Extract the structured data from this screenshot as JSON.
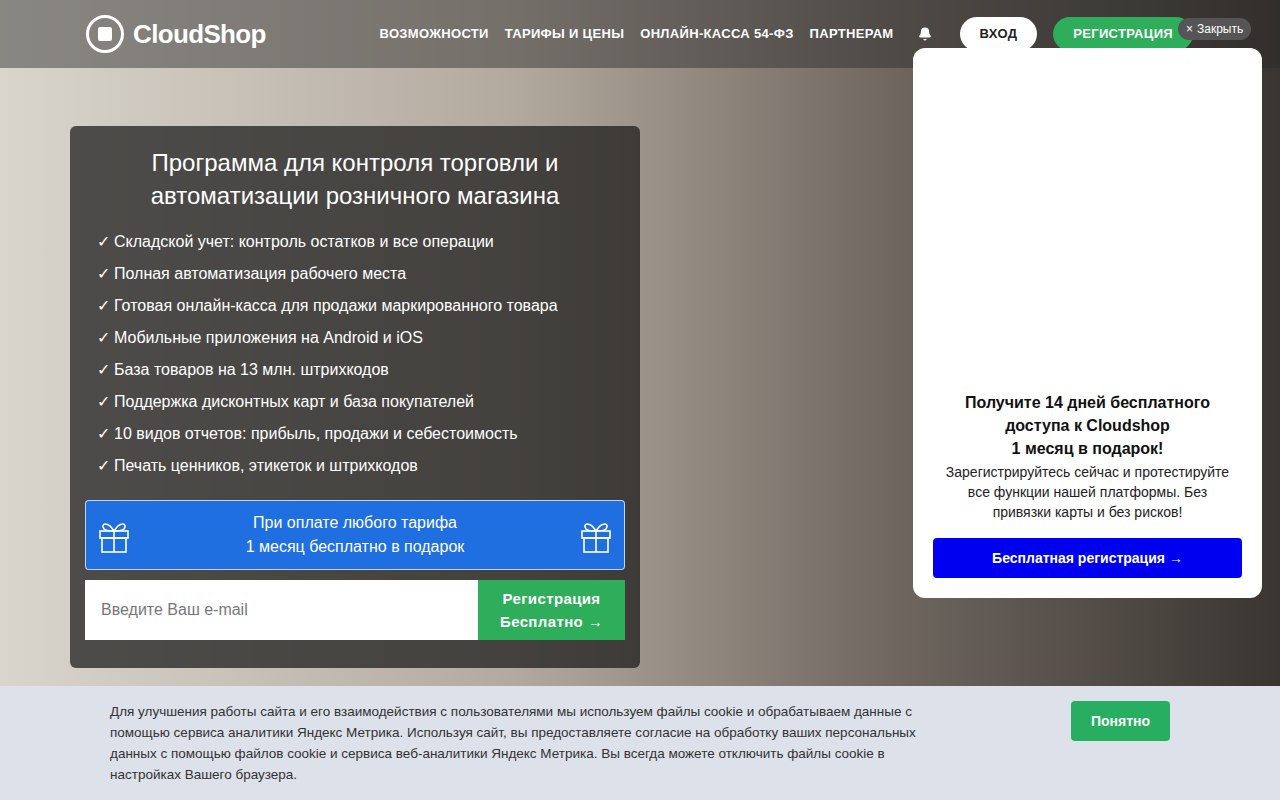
{
  "header": {
    "logo": "CloudShop",
    "nav": [
      "ВОЗМОЖНОСТИ",
      "ТАРИФЫ И ЦЕНЫ",
      "ОНЛАЙН-КАССА 54-ФЗ",
      "ПАРТНЕРАМ"
    ],
    "login": "ВХОД",
    "register": "РЕГИСТРАЦИЯ",
    "close": {
      "icon": "×",
      "label": "Закрыть"
    }
  },
  "hero": {
    "title_lines": [
      "Программа для контроля торговли и",
      "автоматизации розничного магазина"
    ],
    "check": "✓",
    "features": [
      "Складской учет: контроль остатков и все операции",
      "Полная автоматизация рабочего места",
      "Готовая онлайн-касса для продажи маркированного товара",
      "Мобильные приложения на Android и iOS",
      "База товаров на 13 млн. штрихкодов",
      "Поддержка дисконтных карт и база покупателей",
      "10 видов отчетов: прибыль, продажи и себестоимость",
      "Печать ценников, этикеток и штрихкодов"
    ],
    "promo_lines": [
      "При оплате любого тарифа",
      "1 месяц бесплатно в подарок"
    ],
    "email_placeholder": "Введите Ваш e-mail",
    "submit_lines": [
      "Регистрация",
      "Бесплатно →"
    ]
  },
  "popup": {
    "title_lines": [
      "Получите 14 дней бесплатного",
      "доступа к Cloudshop",
      "1 месяц в подарок!"
    ],
    "text": "Зарегистрируйтесь сейчас и протестируйте все функции нашей платформы. Без привязки карты и без рисков!",
    "button": "Бесплатная регистрация →"
  },
  "cookie": {
    "text": "Для улучшения работы сайта и его взаимодействия с пользователями мы используем файлы cookie и обрабатываем данные с помощью сервиса аналитики Яндекс Метрика. Используя сайт, вы предоставляете согласие на обработку ваших персональных данных с помощью файлов cookie и сервиса веб-аналитики Яндекс Метрика. Вы всегда можете отключить файлы cookie в настройках Вашего браузера.",
    "button": "Понятно"
  }
}
